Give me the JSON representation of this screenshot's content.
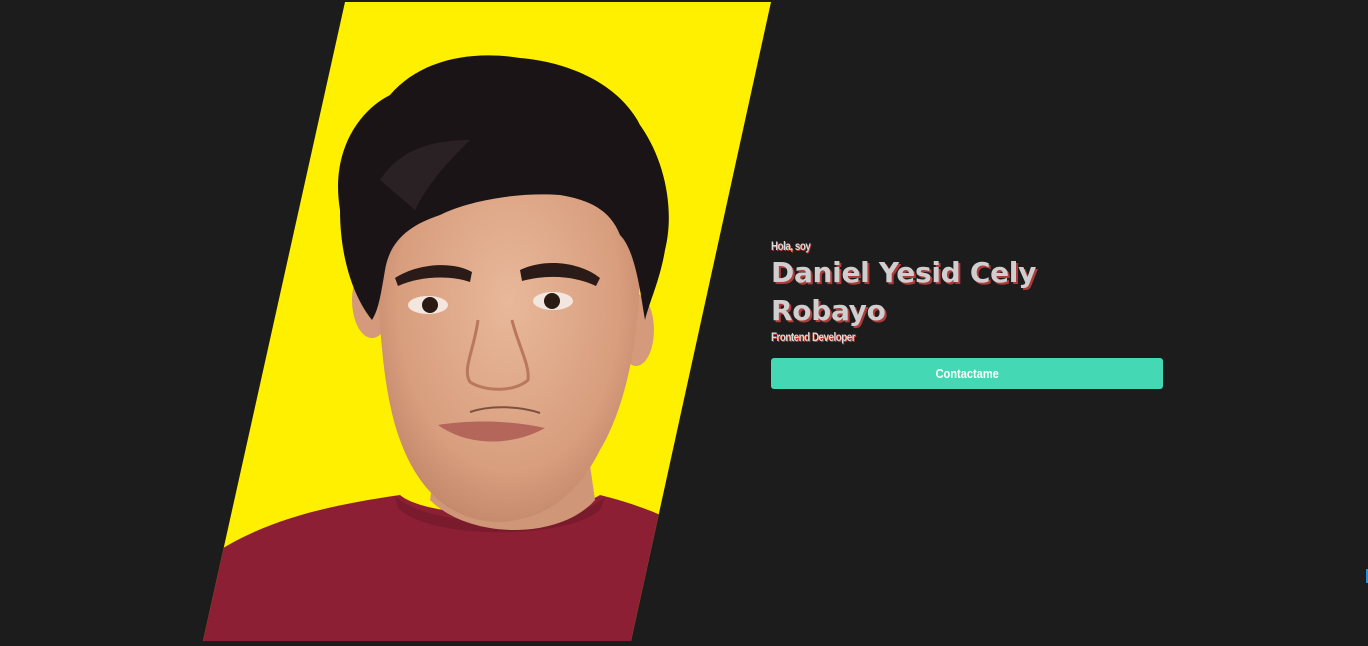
{
  "hero": {
    "greeting": "Hola, soy",
    "name": "Daniel Yesid Cely Robayo",
    "role": "Frontend Developer",
    "contact_label": "Contactame"
  },
  "colors": {
    "background": "#1c1c1c",
    "photo_backdrop": "#fff000",
    "button": "#44d9b4",
    "text_shadow": "#b03a3a"
  }
}
